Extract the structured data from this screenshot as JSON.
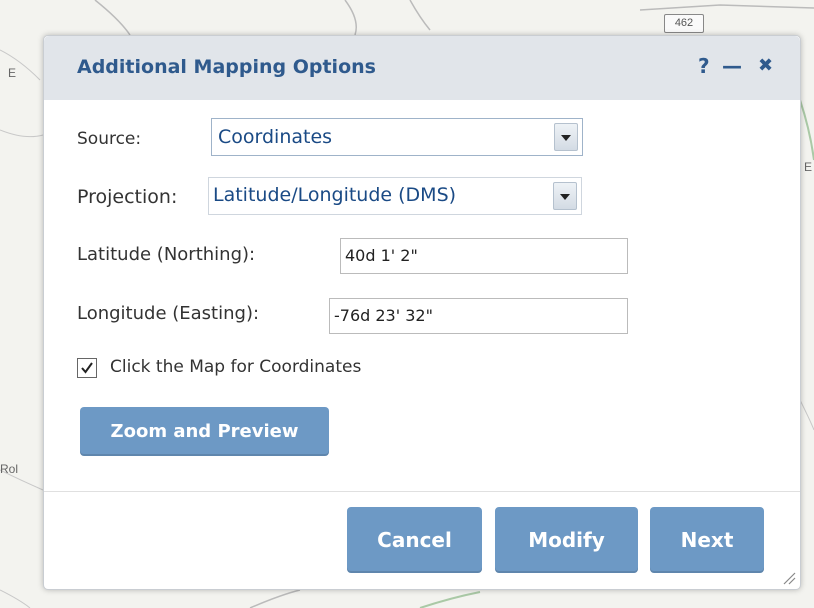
{
  "map": {
    "labels": [
      "E",
      "E",
      "Rol"
    ],
    "shield_label": "462"
  },
  "dialog": {
    "title": "Additional Mapping Options",
    "help_label": "?",
    "minimize_label": "—",
    "close_label": "✖"
  },
  "form": {
    "source_label": "Source:",
    "source_value": "Coordinates",
    "projection_label": "Projection:",
    "projection_value": "Latitude/Longitude (DMS)",
    "latitude_label": "Latitude (Northing):",
    "latitude_value": "40d 1' 2\"",
    "longitude_label": "Longitude (Easting):",
    "longitude_value": "-76d 23' 32\"",
    "click_map_label": "Click the Map for Coordinates",
    "click_map_checked": true,
    "zoom_preview_label": "Zoom and Preview"
  },
  "footer": {
    "cancel_label": "Cancel",
    "modify_label": "Modify",
    "next_label": "Next"
  },
  "colors": {
    "title_text": "#2f5a8d",
    "button_bg": "#6d99c5",
    "titlebar_bg": "#e1e5ea"
  }
}
